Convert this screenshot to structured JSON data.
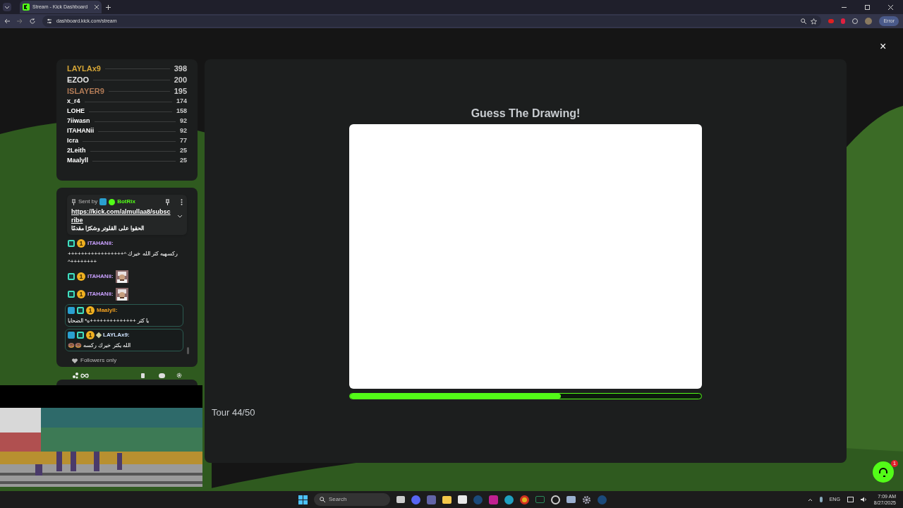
{
  "browser": {
    "tab_title": "Stream - Kick Dashboard",
    "url": "dashboard.kick.com/stream",
    "profile_button": "Error"
  },
  "close": "×",
  "leaderboard": [
    {
      "name": "LAYLAx9",
      "score": "398",
      "kind": "podium",
      "color": "#d4a537"
    },
    {
      "name": "EZOO",
      "score": "200",
      "kind": "podium",
      "color": "#e6e6e6"
    },
    {
      "name": "ISLAYER9",
      "score": "195",
      "kind": "podium",
      "color": "#b07a56"
    },
    {
      "name": "x_r4",
      "score": "174",
      "kind": "regular",
      "color": "#ffffff"
    },
    {
      "name": "LOHE",
      "score": "158",
      "kind": "regular",
      "color": "#ffffff"
    },
    {
      "name": "7iiwasn",
      "score": "92",
      "kind": "regular",
      "color": "#ffffff"
    },
    {
      "name": "ITAHANii",
      "score": "92",
      "kind": "regular",
      "color": "#ffffff"
    },
    {
      "name": "Icra",
      "score": "77",
      "kind": "regular",
      "color": "#ffffff"
    },
    {
      "name": "2Leith",
      "score": "25",
      "kind": "regular",
      "color": "#ffffff"
    },
    {
      "name": "Maalyll",
      "score": "25",
      "kind": "regular",
      "color": "#ffffff"
    }
  ],
  "chat": {
    "pinned": {
      "sent_by": "Sent by",
      "author": "BotRix",
      "link": "https://kick.com/almullaa8/subscribe",
      "text": "الحقوا على القلوتر وشكرًا مقدمًا"
    },
    "messages": [
      {
        "kind": "text",
        "highlighted": false,
        "badges": [
          {
            "kind": "og"
          },
          {
            "kind": "sub",
            "label": "1"
          }
        ],
        "user": "iTAHANii:",
        "color": "#c9a0ff",
        "text": "ركسهيه كثر الله خيرك ^+++++++++++++++++++++++++^"
      },
      {
        "kind": "emote",
        "highlighted": false,
        "badges": [
          {
            "kind": "og"
          },
          {
            "kind": "sub",
            "label": "1"
          }
        ],
        "user": "iTAHANii:",
        "color": "#c9a0ff"
      },
      {
        "kind": "emote",
        "highlighted": false,
        "badges": [
          {
            "kind": "og"
          },
          {
            "kind": "sub",
            "label": "1"
          }
        ],
        "user": "iTAHANii:",
        "color": "#c9a0ff"
      },
      {
        "kind": "text",
        "highlighted": true,
        "badges": [
          {
            "kind": "mod"
          },
          {
            "kind": "og"
          },
          {
            "kind": "sub",
            "label": "1"
          }
        ],
        "user": "Maalyll:",
        "color": "#f0a020",
        "text": "يا كثر ++++++++++++++ه* الضحايا"
      },
      {
        "kind": "text",
        "highlighted": true,
        "badges": [
          {
            "kind": "mod"
          },
          {
            "kind": "og"
          },
          {
            "kind": "sub",
            "label": "1"
          },
          {
            "kind": "sparkle"
          }
        ],
        "user": "LAYLAx9:",
        "color": "#cfe3ff",
        "text": "الله يكثر خيرك ركسه 🍩🍩"
      }
    ],
    "mode": "Followers only"
  },
  "game": {
    "title": "Guess The Drawing!",
    "progress": {
      "level": 0.6
    },
    "round": "Tour 44/50"
  },
  "support": {
    "badge": "1"
  },
  "taskbar": {
    "search_placeholder": "Search",
    "language": "ENG",
    "time": "7:09 AM",
    "date": "8/27/2025"
  }
}
